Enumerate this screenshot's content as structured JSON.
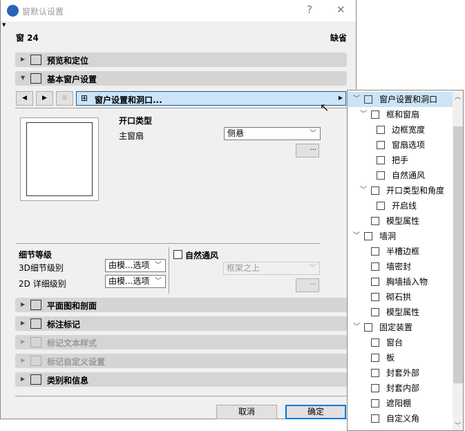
{
  "window": {
    "title": "窗默认设置",
    "help": "?",
    "close": "✕"
  },
  "header": {
    "name": "窗 24",
    "default": "缺省"
  },
  "panels": {
    "preview": "预览和定位",
    "basic": "基本窗户设置",
    "plan": "平面图和剖面",
    "dim": "标注标记",
    "textstyle": "标记文本样式",
    "custom": "标记自定义设置",
    "class": "类别和信息"
  },
  "nav": {
    "prev": "◀",
    "next": "▶",
    "crumb": "窗户设置和洞口...",
    "crumb_arrow": "▶"
  },
  "opening": {
    "title": "开口类型",
    "main_label": "主窗扇",
    "main_value": "侧悬",
    "edit": "..."
  },
  "detail": {
    "title": "细节等级",
    "l3d": "3D细节级别",
    "l3d_value": "由模...选项",
    "l2d": "2D 详细级别",
    "l2d_value": "由模...选项"
  },
  "vent": {
    "label": "自然通风",
    "checked": false,
    "position": "框架之上",
    "edit": "..."
  },
  "buttons": {
    "cancel": "取消",
    "ok": "确定"
  },
  "tree": [
    {
      "label": "窗户设置和洞口",
      "level": 0,
      "expanded": true,
      "selected": true
    },
    {
      "label": "框和窗扇",
      "level": 1,
      "expanded": true
    },
    {
      "label": "边框宽度",
      "level": 2
    },
    {
      "label": "窗扇选项",
      "level": 2
    },
    {
      "label": "把手",
      "level": 2
    },
    {
      "label": "自然通风",
      "level": 2
    },
    {
      "label": "开口类型和角度",
      "level": 1,
      "expanded": true
    },
    {
      "label": "开启线",
      "level": 2
    },
    {
      "label": "模型属性",
      "level": 1
    },
    {
      "label": "墙洞",
      "level": 0,
      "expanded": true
    },
    {
      "label": "半槽边框",
      "level": 1
    },
    {
      "label": "墙密封",
      "level": 1
    },
    {
      "label": "胸墙插入物",
      "level": 1
    },
    {
      "label": "砌石拱",
      "level": 1
    },
    {
      "label": "模型属性",
      "level": 1
    },
    {
      "label": "固定装置",
      "level": 0,
      "expanded": true
    },
    {
      "label": "窗台",
      "level": 1
    },
    {
      "label": "板",
      "level": 1
    },
    {
      "label": "封套外部",
      "level": 1
    },
    {
      "label": "封套内部",
      "level": 1
    },
    {
      "label": "遮阳棚",
      "level": 1
    },
    {
      "label": "自定义角",
      "level": 1
    }
  ]
}
